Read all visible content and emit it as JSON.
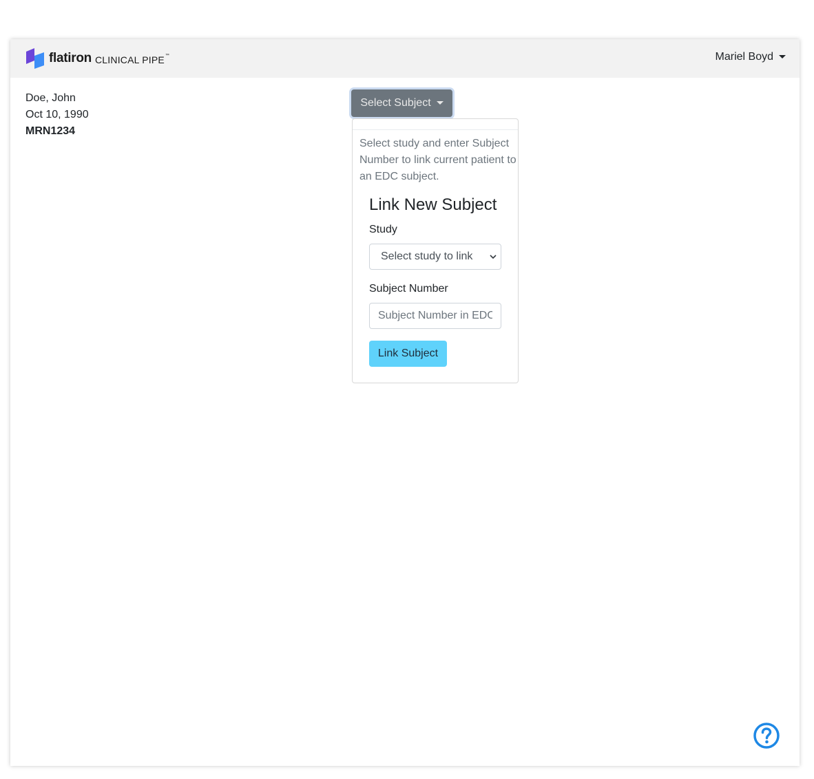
{
  "header": {
    "brand_name": "flatiron",
    "brand_product": "CLINICAL PIPE",
    "trademark": "™",
    "user_name": "Mariel Boyd"
  },
  "patient": {
    "name": "Doe, John",
    "dob": "Oct 10, 1990",
    "mrn": "MRN1234"
  },
  "subject_dropdown": {
    "button_label": "Select Subject",
    "description": "Select study and enter Subject Number to link current patient to an EDC subject.",
    "heading": "Link New Subject",
    "study_label": "Study",
    "study_selected": "Select study to link",
    "subject_number_label": "Subject Number",
    "subject_number_placeholder": "Subject Number in EDC",
    "link_button": "Link Subject"
  },
  "icons": {
    "logo": "flatiron-logo-icon",
    "help": "help-circle-icon"
  },
  "colors": {
    "navbar_bg": "#f2f2f2",
    "secondary_button": "#6c757d",
    "info_button": "#5fd2fb",
    "help_icon": "#1e88e5",
    "logo_purple": "#6b45d9",
    "logo_blue": "#3d8ef7"
  }
}
